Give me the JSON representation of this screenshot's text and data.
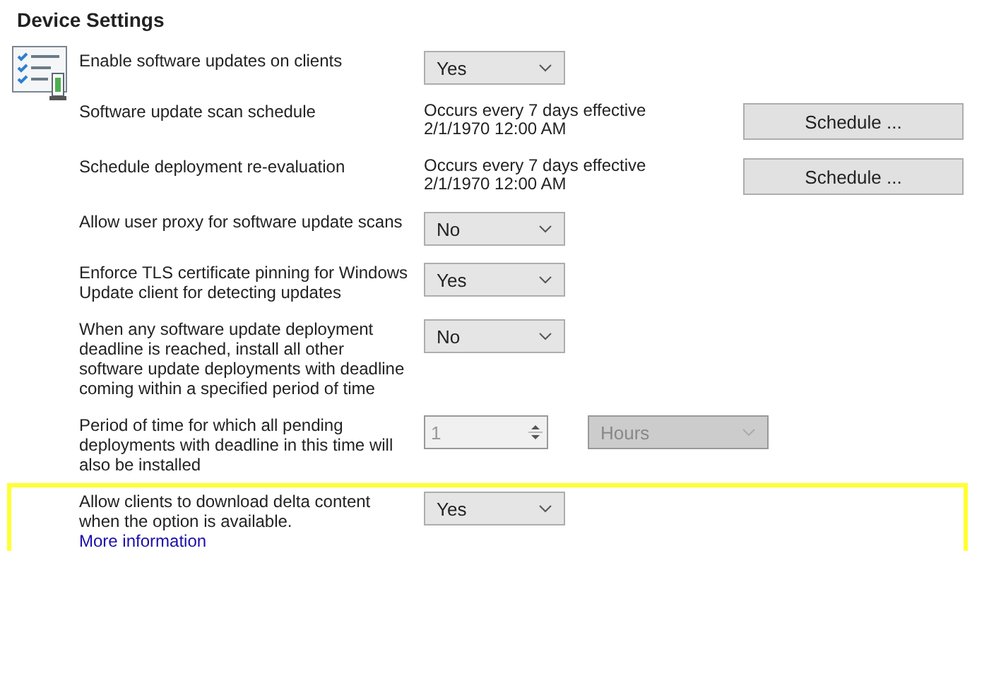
{
  "title": "Device Settings",
  "settings": [
    {
      "label": "Enable software updates on clients",
      "kind": "dropdown",
      "value": "Yes",
      "disabled": false,
      "highlighted": false
    },
    {
      "label": "Software update scan schedule",
      "kind": "schedule",
      "description": "Occurs every 7 days effective 2/1/1970 12:00 AM",
      "button": "Schedule ...",
      "highlighted": false
    },
    {
      "label": "Schedule deployment re-evaluation",
      "kind": "schedule",
      "description": "Occurs every 7 days effective 2/1/1970 12:00 AM",
      "button": "Schedule ...",
      "highlighted": false
    },
    {
      "label": "Allow user proxy for software update scans",
      "kind": "dropdown",
      "value": "No",
      "disabled": false,
      "highlighted": false
    },
    {
      "label": "Enforce TLS certificate pinning for Windows Update client for detecting updates",
      "kind": "dropdown",
      "value": "Yes",
      "disabled": false,
      "highlighted": false
    },
    {
      "label": "When any software update deployment deadline is reached, install all other software update deployments with deadline coming within a specified period of time",
      "kind": "dropdown",
      "value": "No",
      "disabled": false,
      "highlighted": false
    },
    {
      "label": "Period of time for which all pending deployments with deadline in this time will also be installed",
      "kind": "spinner",
      "value": "1",
      "unit": "Hours",
      "disabled": true,
      "highlighted": false
    },
    {
      "label": "Allow clients to download delta content when the option is available.",
      "link": "More information",
      "kind": "dropdown",
      "value": "Yes",
      "disabled": false,
      "highlighted": true
    }
  ]
}
